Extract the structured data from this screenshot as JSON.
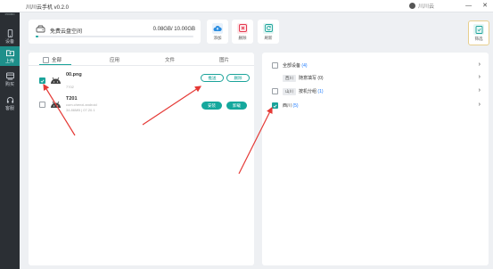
{
  "app": {
    "title": "川川云手机 v0.2.0",
    "user": "川川云"
  },
  "sidebar": {
    "items": [
      {
        "label": "设备",
        "icon": "phone-icon"
      },
      {
        "label": "上传",
        "icon": "folder-icon",
        "active": true
      },
      {
        "label": "购买",
        "icon": "cart-icon"
      },
      {
        "label": "客服",
        "icon": "headset-icon"
      }
    ]
  },
  "storage": {
    "label": "免费云盘空间",
    "value": "0.08GB/ 10.00GB",
    "used_fraction": 0.008
  },
  "toolbar": {
    "add": "添加",
    "delete": "删除",
    "refresh": "刷新",
    "filter": "筛选"
  },
  "files": {
    "tabs": {
      "all": "全部",
      "apps": "应用",
      "docs": "文件",
      "images": "图片"
    },
    "rows": [
      {
        "name": "00.png",
        "sub1": "7702",
        "sub2": "",
        "checked": true,
        "btn1": "推送",
        "btn2": "删除"
      },
      {
        "name": "T201",
        "sub1": "com.chenxi.android",
        "sub2": "34.86MB | 07.20.1",
        "checked": false,
        "btn1": "安装",
        "btn2": "卸载"
      }
    ]
  },
  "devices": {
    "rows": [
      {
        "tag": "",
        "label": "全部设备",
        "count": "(4)",
        "checked": false
      },
      {
        "tag": "西川",
        "label": "随意填写",
        "count": "(0)",
        "checked": false
      },
      {
        "tag": "山川",
        "label": "按机分组",
        "count": "(1)",
        "checked": false
      },
      {
        "tag": "",
        "label": "西川",
        "count": "(5)",
        "checked": true
      }
    ]
  },
  "colors": {
    "accent": "#1aa39a",
    "sidebar": "#2b2f34",
    "arrow": "#e53935",
    "count": "#1677ff"
  }
}
